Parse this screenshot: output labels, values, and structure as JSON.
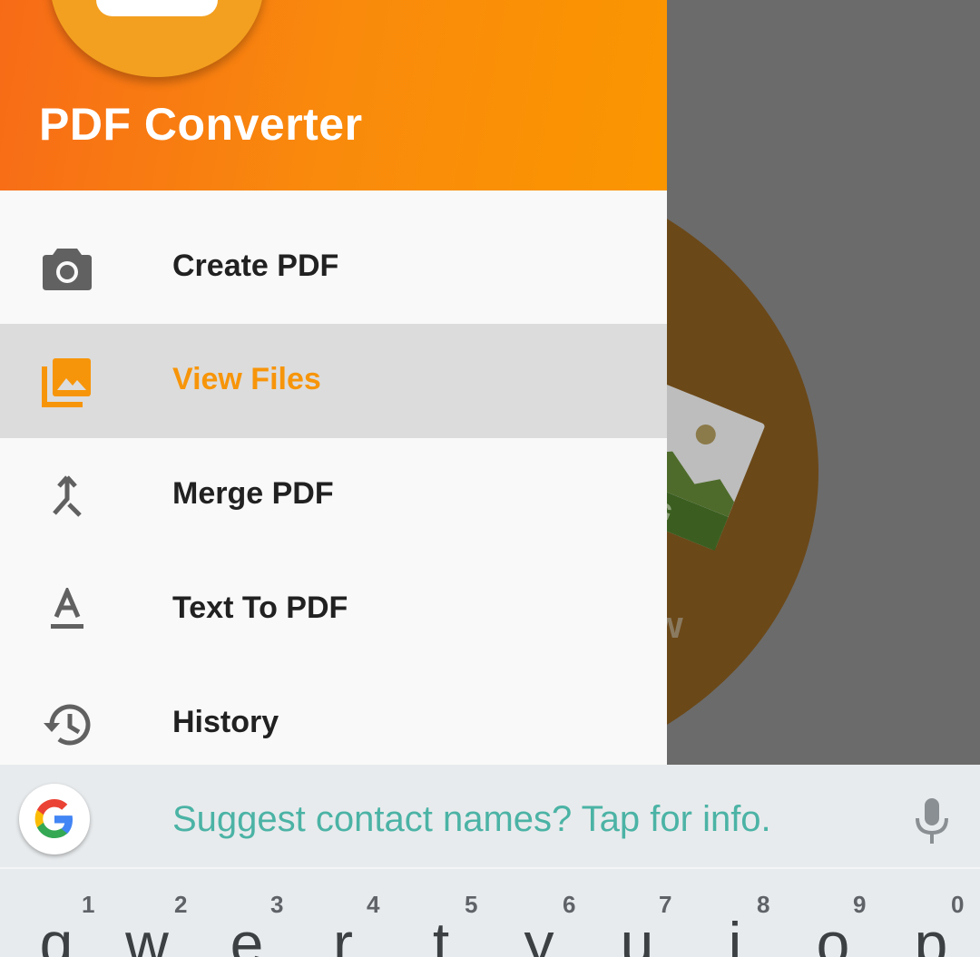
{
  "drawer": {
    "title": "PDF Converter",
    "items": [
      {
        "label": "Create PDF",
        "icon": "camera-icon",
        "active": false
      },
      {
        "label": "View Files",
        "icon": "photo-library-icon",
        "active": true
      },
      {
        "label": "Merge PDF",
        "icon": "merge-icon",
        "active": false
      },
      {
        "label": "Text To PDF",
        "icon": "text-format-icon",
        "active": false
      },
      {
        "label": "History",
        "icon": "history-icon",
        "active": false
      }
    ]
  },
  "background": {
    "file_badge": "NG",
    "partial_label": "w"
  },
  "suggestion_bar": {
    "text": "Suggest contact names? Tap for info."
  },
  "keyboard": {
    "keys": [
      {
        "num": "1",
        "char": "q"
      },
      {
        "num": "2",
        "char": "w"
      },
      {
        "num": "3",
        "char": "e"
      },
      {
        "num": "4",
        "char": "r"
      },
      {
        "num": "5",
        "char": "t"
      },
      {
        "num": "6",
        "char": "y"
      },
      {
        "num": "7",
        "char": "u"
      },
      {
        "num": "8",
        "char": "i"
      },
      {
        "num": "9",
        "char": "o"
      },
      {
        "num": "0",
        "char": "p"
      }
    ]
  },
  "colors": {
    "accent": "#f7950a",
    "header_start": "#f76b17",
    "header_end": "#fb9600",
    "suggest_text": "#4bb3a5"
  }
}
